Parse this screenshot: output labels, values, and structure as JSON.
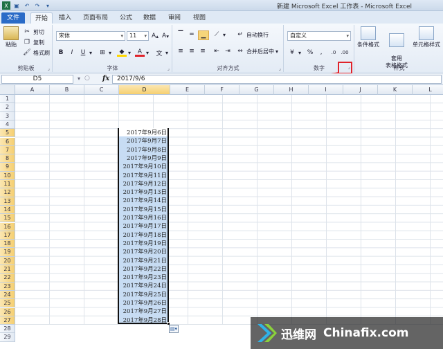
{
  "window": {
    "title": "新建 Microsoft Excel 工作表 - Microsoft Excel"
  },
  "tabs": [
    {
      "label": "文件"
    },
    {
      "label": "开始"
    },
    {
      "label": "插入"
    },
    {
      "label": "页面布局"
    },
    {
      "label": "公式"
    },
    {
      "label": "数据"
    },
    {
      "label": "审阅"
    },
    {
      "label": "视图"
    }
  ],
  "ribbon": {
    "clipboard": {
      "label": "剪贴板",
      "paste": "粘贴",
      "cut": "剪切",
      "copy": "复制",
      "format_painter": "格式刷"
    },
    "font": {
      "label": "字体",
      "font_name": "宋体",
      "font_size": "11"
    },
    "alignment": {
      "label": "对齐方式",
      "wrap_text": "自动换行",
      "merge_center": "合并后居中"
    },
    "number": {
      "label": "数字",
      "format": "自定义"
    },
    "styles": {
      "label": "样式",
      "conditional": "条件格式",
      "table": "套用\n表格格式",
      "cell_styles": "单元格样式"
    }
  },
  "formula_bar": {
    "name_box": "D5",
    "fx": "fx",
    "value": "2017/9/6"
  },
  "columns": [
    "A",
    "B",
    "C",
    "D",
    "E",
    "F",
    "G",
    "H",
    "I",
    "J",
    "K",
    "L"
  ],
  "rows": [
    "1",
    "2",
    "3",
    "4",
    "5",
    "6",
    "7",
    "8",
    "9",
    "10",
    "11",
    "12",
    "13",
    "14",
    "15",
    "16",
    "17",
    "18",
    "19",
    "20",
    "21",
    "22",
    "23",
    "24",
    "25",
    "26",
    "27",
    "28",
    "29"
  ],
  "cells_D": [
    "2017年9月6日",
    "2017年9月7日",
    "2017年9月8日",
    "2017年9月9日",
    "2017年9月10日",
    "2017年9月11日",
    "2017年9月12日",
    "2017年9月13日",
    "2017年9月14日",
    "2017年9月15日",
    "2017年9月16日",
    "2017年9月17日",
    "2017年9月18日",
    "2017年9月19日",
    "2017年9月20日",
    "2017年9月21日",
    "2017年9月22日",
    "2017年9月23日",
    "2017年9月24日",
    "2017年9月25日",
    "2017年9月26日",
    "2017年9月27日",
    "2017年9月28日"
  ],
  "watermark": {
    "brand_cn": "迅维网",
    "brand_en": "Chinafix.com"
  },
  "colors": {
    "annotation": "#e0232b",
    "selection": "#c7dcf3",
    "file_tab": "#2a6bc7"
  }
}
